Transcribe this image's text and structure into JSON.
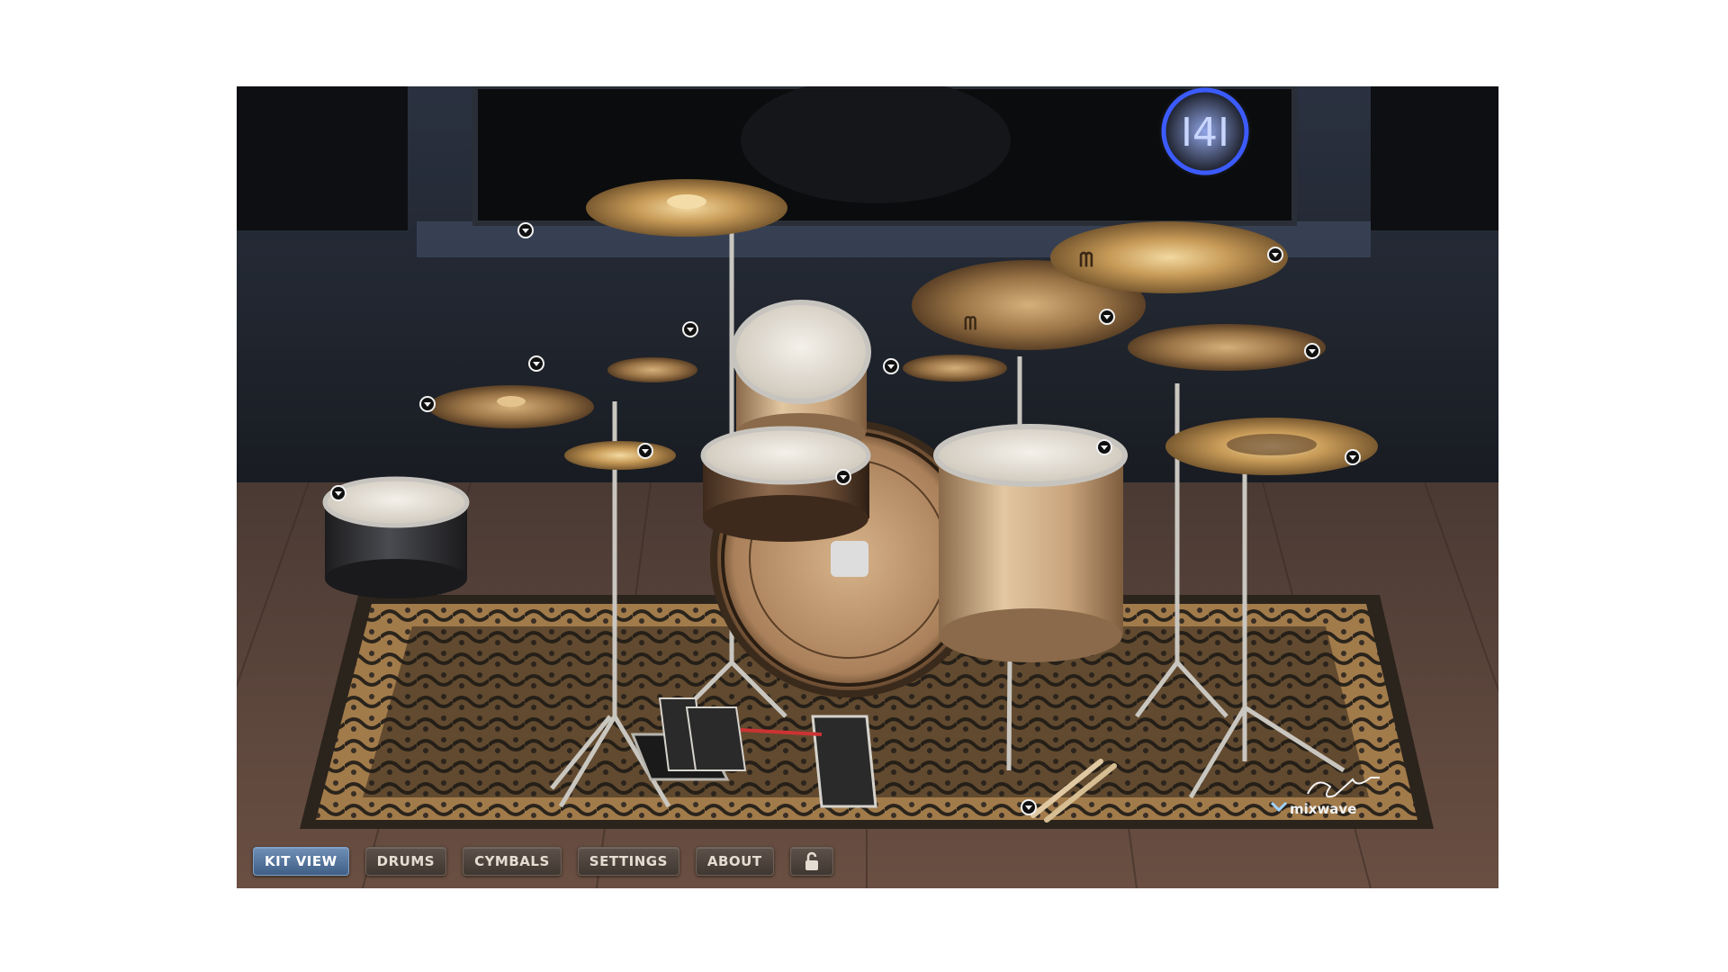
{
  "tabs": [
    {
      "label": "KIT VIEW",
      "active": true
    },
    {
      "label": "DRUMS",
      "active": false
    },
    {
      "label": "CYMBALS",
      "active": false
    },
    {
      "label": "SETTINGS",
      "active": false
    },
    {
      "label": "ABOUT",
      "active": false
    }
  ],
  "lock": {
    "icon": "lock-open-icon"
  },
  "branding": {
    "mixwave_logo": "mixwave",
    "signature": "signature",
    "studio_logo_icon": "studio-logo-icon"
  },
  "colors": {
    "accent": "#4f74a6",
    "tab_bg": "#4a413a",
    "neon": "#3b5bff"
  },
  "kit_pieces": [
    "crash-left",
    "splash",
    "hihat",
    "china-left",
    "rack-tom",
    "snare",
    "side-snare",
    "kick",
    "floor-tom",
    "crash-right",
    "crash-far-right",
    "small-splash",
    "ride",
    "stack",
    "sticks"
  ]
}
